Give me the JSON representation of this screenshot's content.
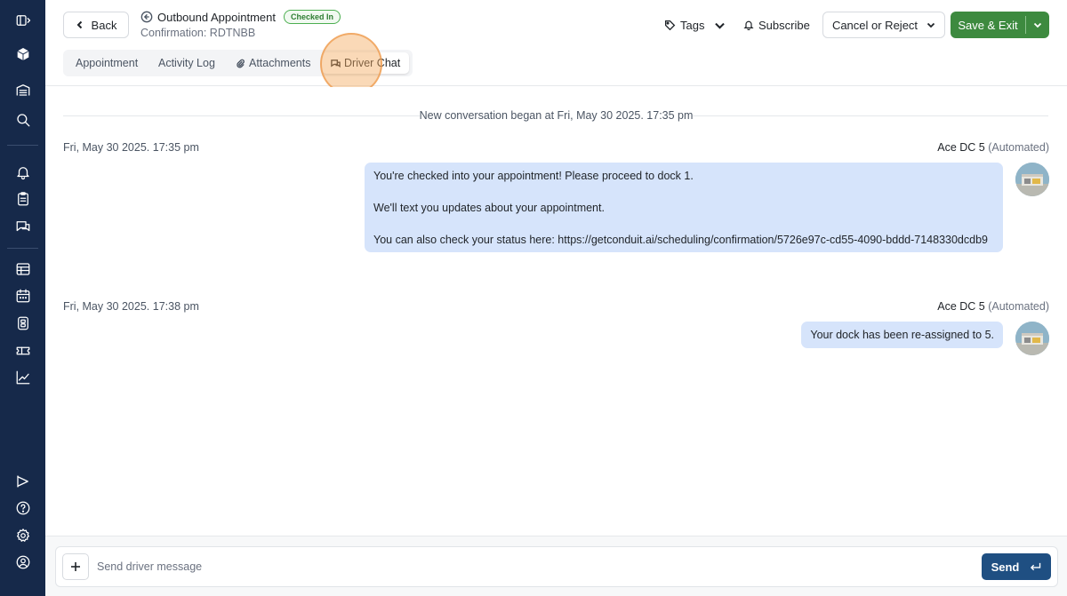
{
  "header": {
    "back_label": "Back",
    "title": "Outbound Appointment",
    "status_badge": "Checked In",
    "confirmation": "Confirmation: RDTNBB",
    "tags_label": "Tags",
    "subscribe_label": "Subscribe",
    "cancel_label": "Cancel or Reject",
    "save_label": "Save & Exit"
  },
  "tabs": [
    {
      "label": "Appointment"
    },
    {
      "label": "Activity Log"
    },
    {
      "label": "Attachments"
    },
    {
      "label": "Driver Chat",
      "active": true
    }
  ],
  "chat": {
    "conversation_start": "New conversation began at Fri, May 30 2025. 17:35 pm",
    "messages": [
      {
        "timestamp": "Fri, May 30 2025. 17:35 pm",
        "sender": "Ace DC 5",
        "sender_tag": "(Automated)",
        "lines": [
          "You're checked into your appointment! Please proceed to dock 1.",
          "We'll text you updates about your appointment.",
          "You can also check your status here: https://getconduit.ai/scheduling/confirmation/5726e97c-cd55-4090-bddd-7148330dcdb9"
        ]
      },
      {
        "timestamp": "Fri, May 30 2025. 17:38 pm",
        "sender": "Ace DC 5",
        "sender_tag": "(Automated)",
        "lines": [
          "Your dock has been re-assigned to 5."
        ]
      }
    ]
  },
  "composer": {
    "placeholder": "Send driver message",
    "value": "",
    "send_label": "Send"
  },
  "colors": {
    "sidebar_bg": "#16294a",
    "save_green": "#3d8a3f",
    "send_blue": "#1f4f82",
    "bubble_bg": "#d6e4fb",
    "badge_green": "#2e7d32"
  },
  "sidebar_icons": [
    "sidebar-toggle-icon",
    "cube-logo-icon",
    "warehouse-icon",
    "search-icon",
    "bell-icon",
    "clipboard-icon",
    "chat-icon",
    "dock-list-icon",
    "calendar-icon",
    "yard-icon",
    "ticket-icon",
    "analytics-icon",
    "send-feedback-icon",
    "help-icon",
    "settings-icon",
    "account-icon"
  ]
}
